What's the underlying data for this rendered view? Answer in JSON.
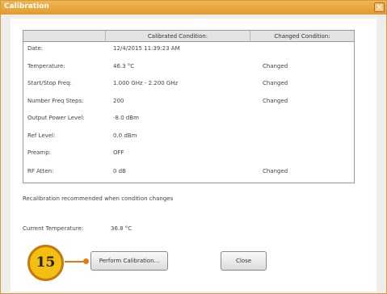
{
  "window": {
    "title": "Calibration"
  },
  "table": {
    "headers": [
      "",
      "Calibrated Condition:",
      "Changed Condition:"
    ],
    "rows": [
      {
        "label": "Date:",
        "value": "12/4/2015 11:39:23 AM",
        "status": ""
      },
      {
        "label": "Temperature:",
        "value": "46.3 °C",
        "status": "Changed"
      },
      {
        "label": "Start/Stop Freq:",
        "value": "1.000 GHz - 2.200 GHz",
        "status": "Changed"
      },
      {
        "label": "Number Freq Steps:",
        "value": "200",
        "status": "Changed"
      },
      {
        "label": "Output Power Level:",
        "value": "-8.0 dBm",
        "status": ""
      },
      {
        "label": "Ref Level:",
        "value": "0.0 dBm",
        "status": ""
      },
      {
        "label": "Preamp:",
        "value": "OFF",
        "status": ""
      },
      {
        "label": "RF Atten:",
        "value": "0 dB",
        "status": "Changed"
      }
    ]
  },
  "note": "Recalibration recommended when condition changes",
  "current": {
    "label": "Current Temperature:",
    "value": "36.8 °C"
  },
  "buttons": {
    "perform": "Perform Calibration...",
    "close": "Close"
  },
  "callout": {
    "number": "15"
  }
}
